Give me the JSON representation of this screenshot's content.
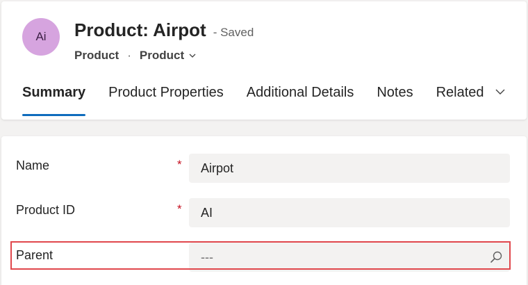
{
  "header": {
    "avatar_initials": "Ai",
    "record_title": "Product: Airpot",
    "save_status": "- Saved",
    "breadcrumb": {
      "entity": "Product",
      "separator": "·",
      "form_selector": "Product"
    }
  },
  "tabs": [
    {
      "label": "Summary",
      "selected": true
    },
    {
      "label": "Product Properties",
      "selected": false
    },
    {
      "label": "Additional Details",
      "selected": false
    },
    {
      "label": "Notes",
      "selected": false
    },
    {
      "label": "Related",
      "selected": false
    }
  ],
  "form": {
    "fields": [
      {
        "label": "Name",
        "required_marker": "*",
        "value": "Airpot"
      },
      {
        "label": "Product ID",
        "required_marker": "*",
        "value": "AI"
      },
      {
        "label": "Parent",
        "placeholder": "---",
        "icon": "search-icon"
      }
    ]
  },
  "colors": {
    "accent": "#0f6cbd",
    "avatar_bg": "#d6a4df",
    "required": "#c50f1f",
    "highlight": "#e0474c"
  }
}
